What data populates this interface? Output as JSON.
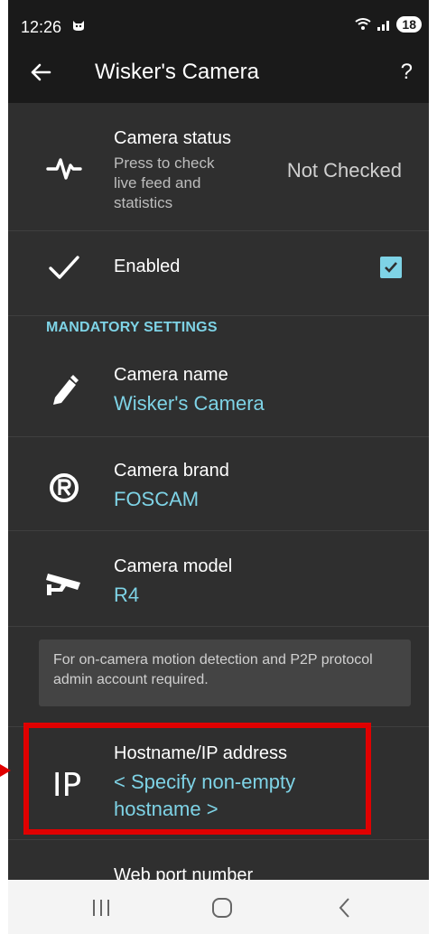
{
  "status_bar": {
    "time": "12:26",
    "battery": "18",
    "icons": [
      "cat-icon",
      "wifi-icon",
      "signal-icon",
      "battery-icon"
    ]
  },
  "app_bar": {
    "title": "Wisker's Camera",
    "help": "?"
  },
  "rows": {
    "camera_status": {
      "label": "Camera status",
      "summary": "Press to check live feed and statistics",
      "value": "Not Checked",
      "icon": "heartbeat-icon"
    },
    "enabled": {
      "label": "Enabled",
      "checked": true,
      "icon": "checkmark-icon"
    },
    "section_mandatory": "MANDATORY SETTINGS",
    "camera_name": {
      "label": "Camera name",
      "value": "Wisker's Camera",
      "icon": "pencil-icon"
    },
    "camera_brand": {
      "label": "Camera brand",
      "value": "FOSCAM",
      "icon": "registered-icon"
    },
    "camera_model": {
      "label": "Camera model",
      "value": "R4",
      "icon": "camera-icon"
    },
    "note": "For on-camera motion detection and P2P protocol admin account required.",
    "hostname": {
      "label": "Hostname/IP address",
      "value": "< Specify non-empty hostname >",
      "icon_text": "IP"
    },
    "web_port": {
      "label": "Web port number",
      "icon": "port-icon"
    }
  },
  "colors": {
    "background": "#2f2f2f",
    "accent": "#7ed3e6",
    "highlight": "#e00000"
  }
}
